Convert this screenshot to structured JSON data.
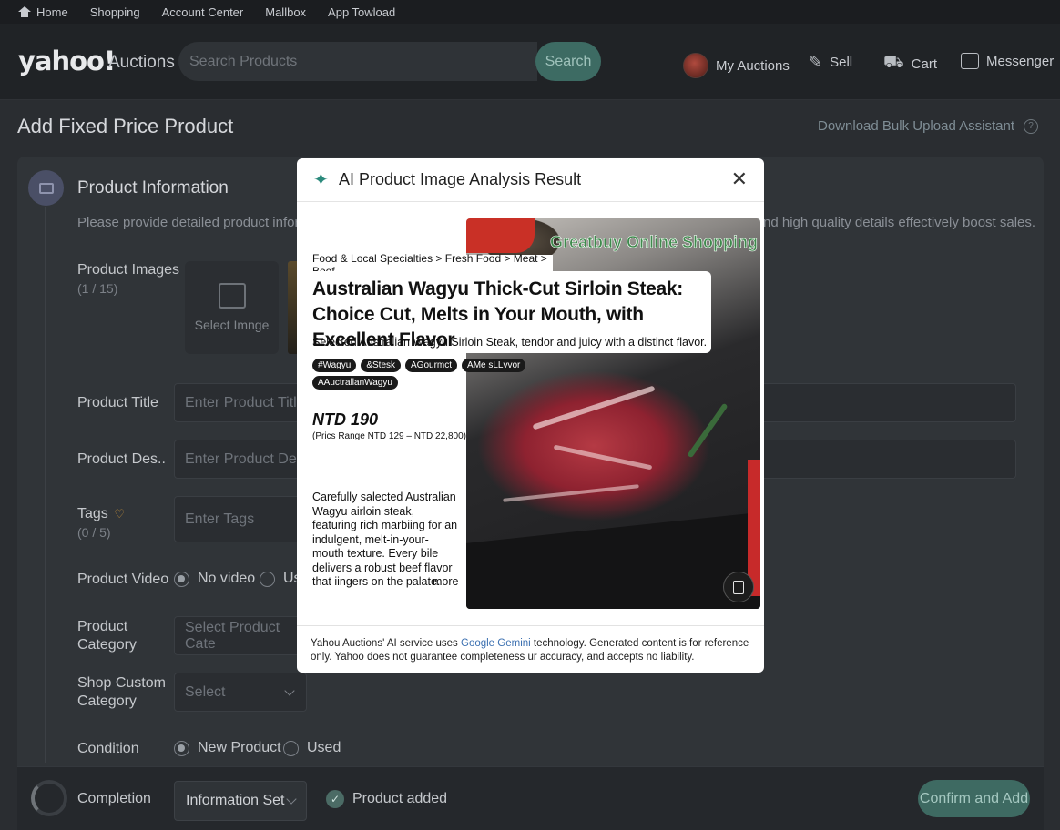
{
  "topbar": {
    "home": "Home",
    "shopping": "Shopping",
    "account_center": "Account Center",
    "mailbox": "Mallbox",
    "app_download": "App Towload"
  },
  "header": {
    "logo": "yahoo!",
    "logo_sub": "Auctions",
    "search_placeholder": "Search Products",
    "search_button": "Search",
    "my_auctions": "My Auctions",
    "sell": "Sell",
    "cart": "Cart",
    "messenger": "Messenger"
  },
  "page": {
    "title": "Add Fixed Price Product",
    "bulk_upload": "Download Bulk Upload Assistant"
  },
  "section": {
    "title": "Product Information",
    "desc_left": "Please provide detailed product informa",
    "desc_right": "nd high quality details effectively boost sales."
  },
  "form": {
    "images_label": "Product Images",
    "images_count": "(1 / 15)",
    "select_image": "Select Imnge",
    "title_label": "Product Title",
    "title_placeholder": "Enter Product Title",
    "desc_label": "Product Des..",
    "desc_placeholder": "Enter Product Descr",
    "tags_label": "Tags",
    "tags_count": "(0 / 5)",
    "tags_placeholder": "Enter Tags",
    "video_label": "Product Video",
    "video_no": "No video",
    "video_use": "Us",
    "category_label_1": "Product",
    "category_label_2": "Category",
    "category_placeholder": "Select Product Cate",
    "shop_category_label_1": "Shop Custom",
    "shop_category_label_2": "Category",
    "shop_category_placeholder": "Select",
    "condition_label": "Condition",
    "condition_new": "New Product",
    "condition_used": "Used"
  },
  "bottom": {
    "completion": "Completion",
    "select_value": "Information Set",
    "status": "Product added",
    "confirm": "Confirm and Add"
  },
  "modal": {
    "title": "AI Product Image Analysis Result",
    "shop_watermark": "Greatbuy Online Shopping",
    "breadcrumb": "Food & Local Specialties > Fresh Food > Meat > Beef",
    "product_title": "Australian Wagyu Thick-Cut Sirloin Steak: Choice Cut, Melts in Your Mouth, with Excellent Flavor",
    "subtitle": "Selected Australian Wagyu Sirloin Steak, tendor and juicy with a distinct flavor.",
    "tags": [
      "#Wagyu",
      "&Stesk",
      "AGourmct",
      "AMe sLLvvor",
      "AAuctrallanWagyu"
    ],
    "price": "NTD 190",
    "price_range": "(Prics Range NTD 129 – NTD 22,800)",
    "description": "Carefully salected Australian Wagyu airloin steak, featuring rich marbiing for an indulgent, melt-in-your-mouth texture. Every bile delivers a robust beef flavor that iingers on the palate.",
    "more": "more",
    "footer_pre": "Yahou Auctions' AI service uses ",
    "footer_link": "Google Gemini",
    "footer_post": " technology. Generated content is for reference only. Yahoo does not guarantee completeness ur accuracy, and accepts no liability."
  }
}
